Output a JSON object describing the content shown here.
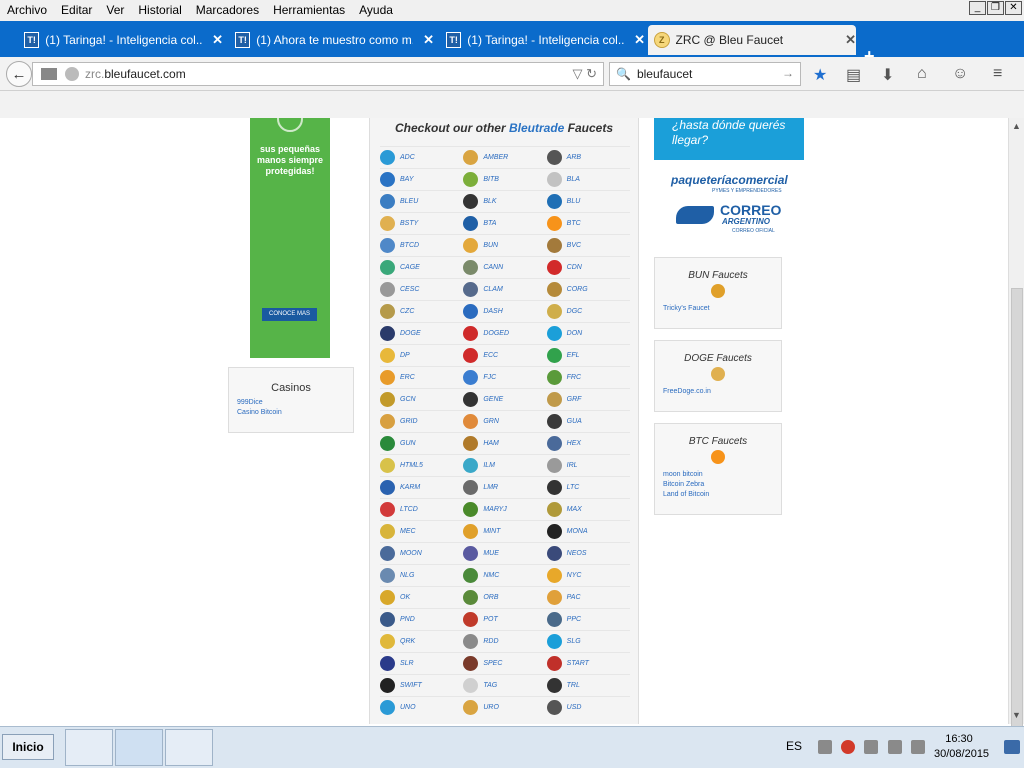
{
  "menu": [
    "Archivo",
    "Editar",
    "Ver",
    "Historial",
    "Marcadores",
    "Herramientas",
    "Ayuda"
  ],
  "tabs": [
    {
      "icon": "T!",
      "title": "(1) Taringa! - Inteligencia col...",
      "active": false
    },
    {
      "icon": "T!",
      "title": "(1) Ahora te muestro como m...",
      "active": false
    },
    {
      "icon": "T!",
      "title": "(1) Taringa! - Inteligencia col...",
      "active": false
    },
    {
      "icon": "",
      "title": "ZRC @ Bleu Faucet",
      "active": true
    }
  ],
  "url": {
    "prefix": "zrc.",
    "domain": "bleufaucet.com"
  },
  "search": {
    "value": "bleufaucet"
  },
  "leftad": {
    "text": "sus pequeñas manos siempre protegidas!",
    "button": "CONOCE MAS"
  },
  "casinos": {
    "title": "Casinos",
    "links": [
      "999Dice",
      "Casino Bitcoin"
    ]
  },
  "center": {
    "title_pre": "Checkout our other ",
    "title_hl": "Bleutrade",
    "title_post": " Faucets"
  },
  "coins": [
    [
      "ADC",
      "AMBER",
      "ARB"
    ],
    [
      "BAY",
      "BITB",
      "BLA"
    ],
    [
      "BLEU",
      "BLK",
      "BLU"
    ],
    [
      "BSTY",
      "BTA",
      "BTC"
    ],
    [
      "BTCD",
      "BUN",
      "BVC"
    ],
    [
      "CAGE",
      "CANN",
      "CDN"
    ],
    [
      "CESC",
      "CLAM",
      "CORG"
    ],
    [
      "CZC",
      "DASH",
      "DGC"
    ],
    [
      "DOGE",
      "DOGED",
      "DON"
    ],
    [
      "DP",
      "ECC",
      "EFL"
    ],
    [
      "ERC",
      "FJC",
      "FRC"
    ],
    [
      "GCN",
      "GENE",
      "GRF"
    ],
    [
      "GRID",
      "GRN",
      "GUA"
    ],
    [
      "GUN",
      "HAM",
      "HEX"
    ],
    [
      "HTML5",
      "ILM",
      "IRL"
    ],
    [
      "KARM",
      "LMR",
      "LTC"
    ],
    [
      "LTCD",
      "MARYJ",
      "MAX"
    ],
    [
      "MEC",
      "MINT",
      "MONA"
    ],
    [
      "MOON",
      "MUE",
      "NEOS"
    ],
    [
      "NLG",
      "NMC",
      "NYC"
    ],
    [
      "OK",
      "ORB",
      "PAC"
    ],
    [
      "PND",
      "POT",
      "PPC"
    ],
    [
      "QRK",
      "RDD",
      "SLG"
    ],
    [
      "SLR",
      "SPEC",
      "START"
    ],
    [
      "SWIFT",
      "TAG",
      "TRL"
    ],
    [
      "UNO",
      "URO",
      "USD"
    ]
  ],
  "coin_colors": [
    "#2a9ad6",
    "#d9a441",
    "#555555",
    "#2a73c4",
    "#7cae3a",
    "#c2c2c2",
    "#3b7dc2",
    "#333333",
    "#1f6fb5",
    "#e0b050",
    "#1f5fa6",
    "#f7931a",
    "#4f88c8",
    "#e3a83b",
    "#a37a3b",
    "#3aa87a",
    "#7a8a6a",
    "#d22a2a",
    "#999999",
    "#566a8c",
    "#b58a3a",
    "#b59a4a",
    "#2a6bbf",
    "#cfae4b",
    "#2a3a6a",
    "#cf2a2a",
    "#1b9fd9",
    "#e8b83a",
    "#d02a2a",
    "#31a24c",
    "#e89b2a",
    "#3a7dd0",
    "#5a9a3a",
    "#c29a2a",
    "#333333",
    "#c09a4a",
    "#d8a040",
    "#e08a3a",
    "#3a3a3a",
    "#2a8a3a",
    "#b07a2a",
    "#4a6a9a",
    "#d8c24a",
    "#3aa8c8",
    "#9a9a9a",
    "#2a62b0",
    "#6a6a6a",
    "#333333",
    "#d23a3a",
    "#4a8a2a",
    "#b09a3a",
    "#d8b43a",
    "#e0a02a",
    "#222222",
    "#4a6a9a",
    "#5a5aa0",
    "#3a4a7a",
    "#6a8ab0",
    "#4a8a3a",
    "#e8a82a",
    "#d8a82a",
    "#5a8a3a",
    "#e0a03a",
    "#3a5a8a",
    "#c03a2a",
    "#4a6a8a",
    "#e0b83a",
    "#8a8a8a",
    "#1b9fd9",
    "#2a3a8a",
    "#7a3a2a",
    "#c0302a",
    "#222222",
    "#d0d0d0",
    "#333333"
  ],
  "rightad": {
    "text": "¿hasta dónde querés llegar?"
  },
  "paq": {
    "title": "paqueteríacomercial",
    "sub": "PYMES Y EMPRENDEDORES"
  },
  "correo": {
    "line1": "CORREO",
    "line2": "ARGENTINO",
    "line3": "CORREO OFICIAL"
  },
  "faucet_boxes": [
    {
      "title": "BUN Faucets",
      "color": "#e0a02a",
      "links": [
        "Tricky's Faucet"
      ]
    },
    {
      "title": "DOGE Faucets",
      "color": "#e0b050",
      "links": [
        "FreeDoge.co.in"
      ]
    },
    {
      "title": "BTC Faucets",
      "color": "#f7931a",
      "links": [
        "moon bitcoin",
        "Bitcoin Zebra",
        "Land of Bitcoin"
      ]
    }
  ],
  "taskbar": {
    "start": "Inicio",
    "lang": "ES",
    "time": "16:30",
    "date": "30/08/2015"
  }
}
